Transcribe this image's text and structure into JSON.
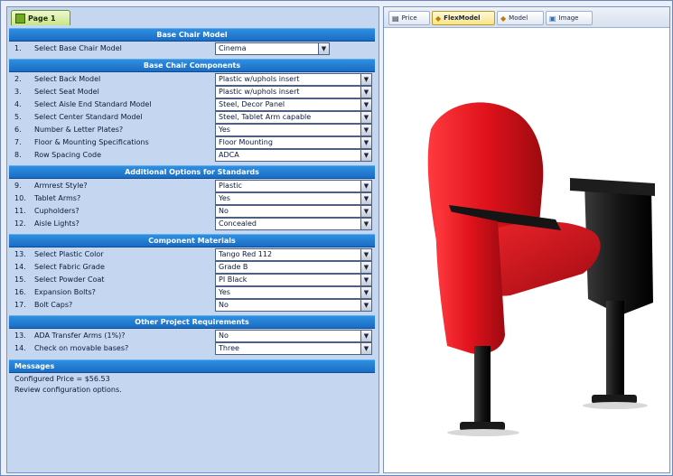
{
  "page_tab": "Page 1",
  "sections": {
    "base_model": "Base Chair Model",
    "components": "Base Chair Components",
    "options": "Additional Options for Standards",
    "materials": "Component Materials",
    "project": "Other Project Requirements",
    "messages": "Messages"
  },
  "rows": [
    {
      "num": "1.",
      "label": "Select Base Chair Model",
      "value": "Cinema"
    },
    {
      "num": "2.",
      "label": "Select Back Model",
      "value": "Plastic w/uphols insert"
    },
    {
      "num": "3.",
      "label": "Select Seat Model",
      "value": "Plastic w/uphols insert"
    },
    {
      "num": "4.",
      "label": "Select Aisle End Standard Model",
      "value": "Steel, Decor Panel"
    },
    {
      "num": "5.",
      "label": "Select Center Standard Model",
      "value": "Steel, Tablet Arm capable"
    },
    {
      "num": "6.",
      "label": "Number & Letter Plates?",
      "value": "Yes"
    },
    {
      "num": "7.",
      "label": "Floor & Mounting Specifications",
      "value": "Floor Mounting"
    },
    {
      "num": "8.",
      "label": "Row Spacing Code",
      "value": "ADCA"
    },
    {
      "num": "9.",
      "label": "Armrest Style?",
      "value": "Plastic"
    },
    {
      "num": "10.",
      "label": "Tablet Arms?",
      "value": "Yes"
    },
    {
      "num": "11.",
      "label": "Cupholders?",
      "value": "No"
    },
    {
      "num": "12.",
      "label": "Aisle Lights?",
      "value": "Concealed"
    },
    {
      "num": "13.",
      "label": "Select Plastic Color",
      "value": "Tango Red 112"
    },
    {
      "num": "14.",
      "label": "Select Fabric Grade",
      "value": "Grade B"
    },
    {
      "num": "15.",
      "label": "Select Powder Coat",
      "value": "PI Black"
    },
    {
      "num": "16.",
      "label": "Expansion Bolts?",
      "value": "Yes"
    },
    {
      "num": "17.",
      "label": "Bolt Caps?",
      "value": "No"
    },
    {
      "num": "13.",
      "label": "ADA Transfer Arms (1%)?",
      "value": "No"
    },
    {
      "num": "14.",
      "label": "Check on movable bases?",
      "value": "Three"
    }
  ],
  "messages": {
    "line1": "Configured Price = $56.53",
    "line2": "Review configuration options."
  },
  "viewer_tabs": [
    {
      "label": "Price",
      "icon": "price-icon"
    },
    {
      "label": "FlexModel",
      "icon": "flexmodel-icon"
    },
    {
      "label": "Model",
      "icon": "model-icon"
    },
    {
      "label": "Image",
      "icon": "image-icon"
    }
  ],
  "colors": {
    "panel": "#c5d6f0",
    "section_header": "#1f7ad2",
    "seat_red": "#e0121b",
    "frame_black": "#151515",
    "active_tab": "#f7e48a"
  }
}
